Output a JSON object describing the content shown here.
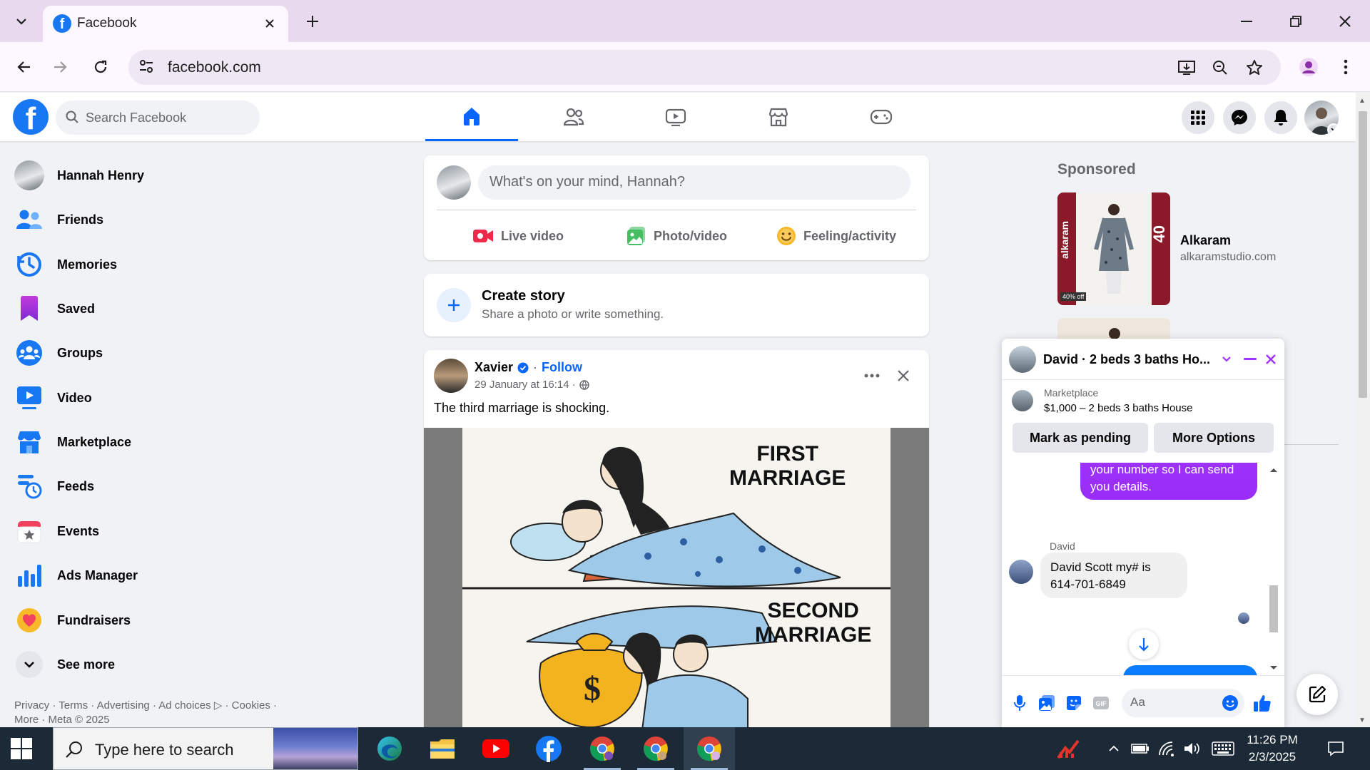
{
  "browser": {
    "tab_title": "Facebook",
    "url": "facebook.com"
  },
  "header": {
    "search_placeholder": "Search Facebook",
    "nav_tabs": [
      "home",
      "friends",
      "video",
      "marketplace",
      "gaming"
    ],
    "active_tab": "home"
  },
  "sidebar": {
    "profile_name": "Hannah Henry",
    "items": [
      {
        "label": "Friends",
        "icon": "friends-icon"
      },
      {
        "label": "Memories",
        "icon": "memories-icon"
      },
      {
        "label": "Saved",
        "icon": "saved-icon"
      },
      {
        "label": "Groups",
        "icon": "groups-icon"
      },
      {
        "label": "Video",
        "icon": "video-icon"
      },
      {
        "label": "Marketplace",
        "icon": "marketplace-icon"
      },
      {
        "label": "Feeds",
        "icon": "feeds-icon"
      },
      {
        "label": "Events",
        "icon": "events-icon"
      },
      {
        "label": "Ads Manager",
        "icon": "ads-manager-icon"
      },
      {
        "label": "Fundraisers",
        "icon": "fundraisers-icon"
      }
    ],
    "see_more": "See more",
    "footer_line1": "Privacy · Terms · Advertising · Ad choices ▷ · Cookies ·",
    "footer_line2": "More · Meta © 2025"
  },
  "composer": {
    "placeholder": "What's on your mind, Hannah?",
    "actions": [
      "Live video",
      "Photo/video",
      "Feeling/activity"
    ]
  },
  "story": {
    "title": "Create story",
    "subtitle": "Share a photo or write something."
  },
  "post": {
    "author": "Xavier",
    "follow": "Follow",
    "separator": "·",
    "date": "29 January at 16:14 ·",
    "text": "The third marriage is shocking.",
    "image_labels": {
      "first": "FIRST\nMARRIAGE",
      "second": "SECOND\nMARRIAGE"
    }
  },
  "sponsored": {
    "heading": "Sponsored",
    "ad_name": "Alkaram",
    "ad_domain": "alkaramstudio.com",
    "ad_brand_text": "alkaram",
    "ad_discount_text": "40",
    "ad_badge": "40% off"
  },
  "chat": {
    "title": "David · 2 beds 3 baths Ho...",
    "marketplace_label": "Marketplace",
    "listing": "$1,000 – 2 beds 3 baths House",
    "btn_pending": "Mark as pending",
    "btn_more": "More Options",
    "out_message": "your number so I can send you details.",
    "sender": "David",
    "in_message": "David Scott my# is 614-701-6849",
    "input_placeholder": "Aa"
  },
  "taskbar": {
    "search_placeholder": "Type here to search",
    "time": "11:26 PM",
    "date": "2/3/2025"
  },
  "colors": {
    "fb_blue": "#1877f2",
    "messenger_purple": "#a033ff",
    "tab_bar": "#e8d9ee"
  }
}
